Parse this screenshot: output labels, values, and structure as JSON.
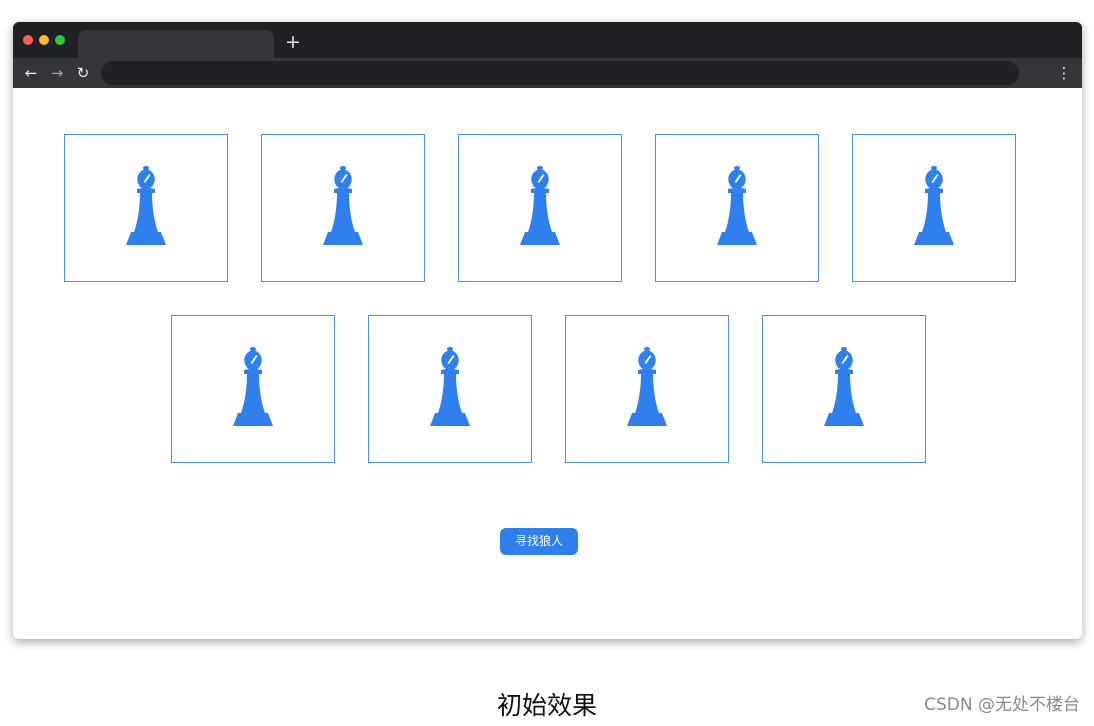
{
  "browser": {
    "new_tab_label": "+",
    "back_icon": "←",
    "forward_icon": "→",
    "reload_icon": "↻",
    "menu_icon": "⋮"
  },
  "main": {
    "cards": [
      {
        "icon": "chess-bishop-icon"
      },
      {
        "icon": "chess-bishop-icon"
      },
      {
        "icon": "chess-bishop-icon"
      },
      {
        "icon": "chess-bishop-icon"
      },
      {
        "icon": "chess-bishop-icon"
      },
      {
        "icon": "chess-bishop-icon"
      },
      {
        "icon": "chess-bishop-icon"
      },
      {
        "icon": "chess-bishop-icon"
      },
      {
        "icon": "chess-bishop-icon"
      }
    ],
    "find_button_label": "寻找狼人"
  },
  "caption": "初始效果",
  "watermark": "CSDN @无处不楼台",
  "colors": {
    "accent": "#2f80ed",
    "card_border": "#4a90e2",
    "titlebar": "#202124",
    "toolbar": "#35363a"
  }
}
